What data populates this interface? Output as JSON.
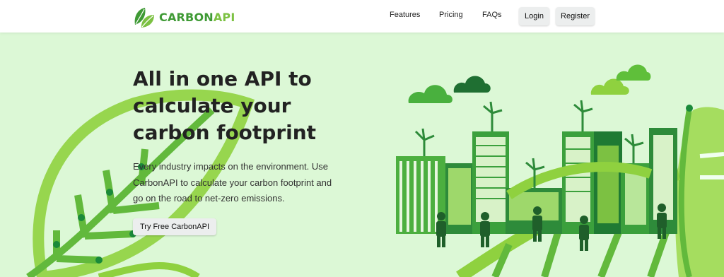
{
  "brand": {
    "name_part1": "CARBON",
    "name_part2": "API",
    "primary_color": "#3f9a35",
    "accent_color": "#7cc142"
  },
  "nav": {
    "links": [
      "Features",
      "Pricing",
      "FAQs"
    ],
    "login_label": "Login",
    "register_label": "Register"
  },
  "hero": {
    "headline_lines": [
      "All in one API to",
      "calculate your",
      "carbon footprint"
    ],
    "subtext_lines": [
      "Every industry impacts on the environment. Use",
      "CarbonAPI to calculate your carbon footprint and",
      "go on the road to net-zero emissions."
    ],
    "cta_label": "Try Free CarbonAPI",
    "background_color": "#dcf8d6"
  },
  "icons": [
    "leaf-logo-icon",
    "cloud-icon",
    "wind-turbine-icon",
    "building-icon",
    "person-icon",
    "leaf-decoration-icon"
  ]
}
